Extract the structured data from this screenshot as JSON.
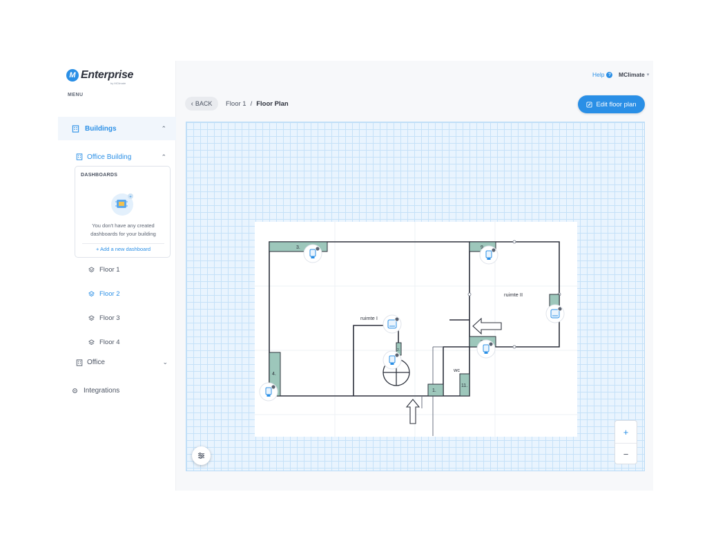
{
  "brand": {
    "name": "Enterprise",
    "sub": "by MClimate",
    "badge": "M"
  },
  "menu_label": "MENU",
  "header": {
    "help": "Help",
    "user": "MClimate"
  },
  "sidebar": {
    "buildings": "Buildings",
    "office_building": "Office Building",
    "dashboards": {
      "title": "DASHBOARDS",
      "empty_text": "You don't have any created dashboards for your building",
      "add_link": "+ Add a new dashboard"
    },
    "floors": [
      "Floor 1",
      "Floor 2",
      "Floor 3",
      "Floor 4"
    ],
    "office": "Office",
    "integrations": "Integrations"
  },
  "toolbar": {
    "back": "BACK",
    "breadcrumb": [
      "Floor 1",
      "Floor Plan"
    ],
    "separator": "/",
    "edit_button": "Edit floor plan"
  },
  "zoom": {
    "in": "+",
    "out": "−"
  },
  "floor_plan": {
    "rooms": [
      "ruimte I",
      "ruimte II",
      "wc"
    ],
    "radiator_labels": [
      "3.",
      "9.",
      "4.",
      "5.",
      "1.",
      "11.",
      "2."
    ]
  },
  "colors": {
    "accent": "#2a8fe6",
    "radiator": "#9dc7bb",
    "grid": "#c5e1f8"
  }
}
